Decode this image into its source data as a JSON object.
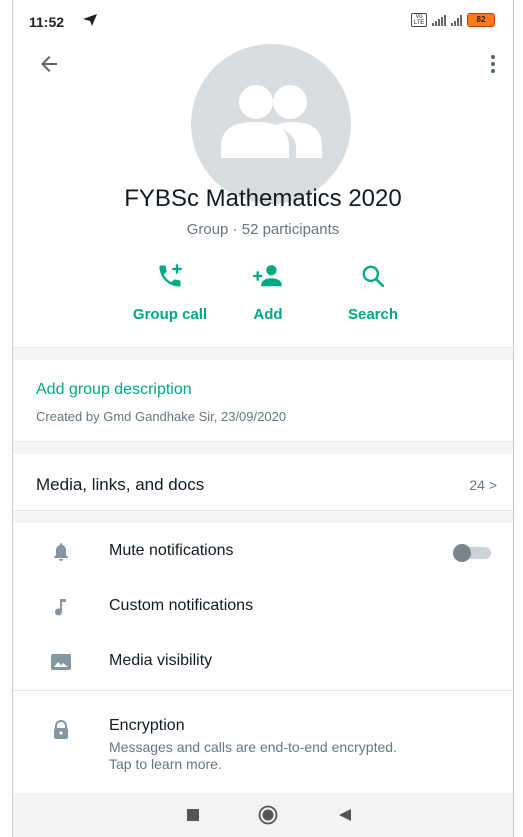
{
  "status_bar": {
    "time": "11:52",
    "battery": "82",
    "network": "4G"
  },
  "group": {
    "name": "FYBSc Mathematics 2020",
    "meta": "Group · 52 participants"
  },
  "actions": [
    {
      "label": "Group call",
      "icon": "group-call-icon"
    },
    {
      "label": "Add",
      "icon": "add-participant-icon"
    },
    {
      "label": "Search",
      "icon": "search-icon"
    }
  ],
  "description": {
    "link": "Add group description",
    "created": "Created by Gmd Gandhake Sir, 23/09/2020"
  },
  "media": {
    "label": "Media, links, and docs",
    "count": "24 >"
  },
  "settings": [
    {
      "label": "Mute notifications",
      "icon": "bell-icon",
      "toggle": false
    },
    {
      "label": "Custom notifications",
      "icon": "music-note-icon"
    },
    {
      "label": "Media visibility",
      "icon": "image-icon"
    }
  ],
  "encryption": {
    "title": "Encryption",
    "subtitle": "Messages and calls are end-to-end encrypted. Tap to learn more."
  },
  "colors": {
    "accent": "#00a884",
    "muted_text": "#667781",
    "avatar_bg": "#d9dde0"
  }
}
